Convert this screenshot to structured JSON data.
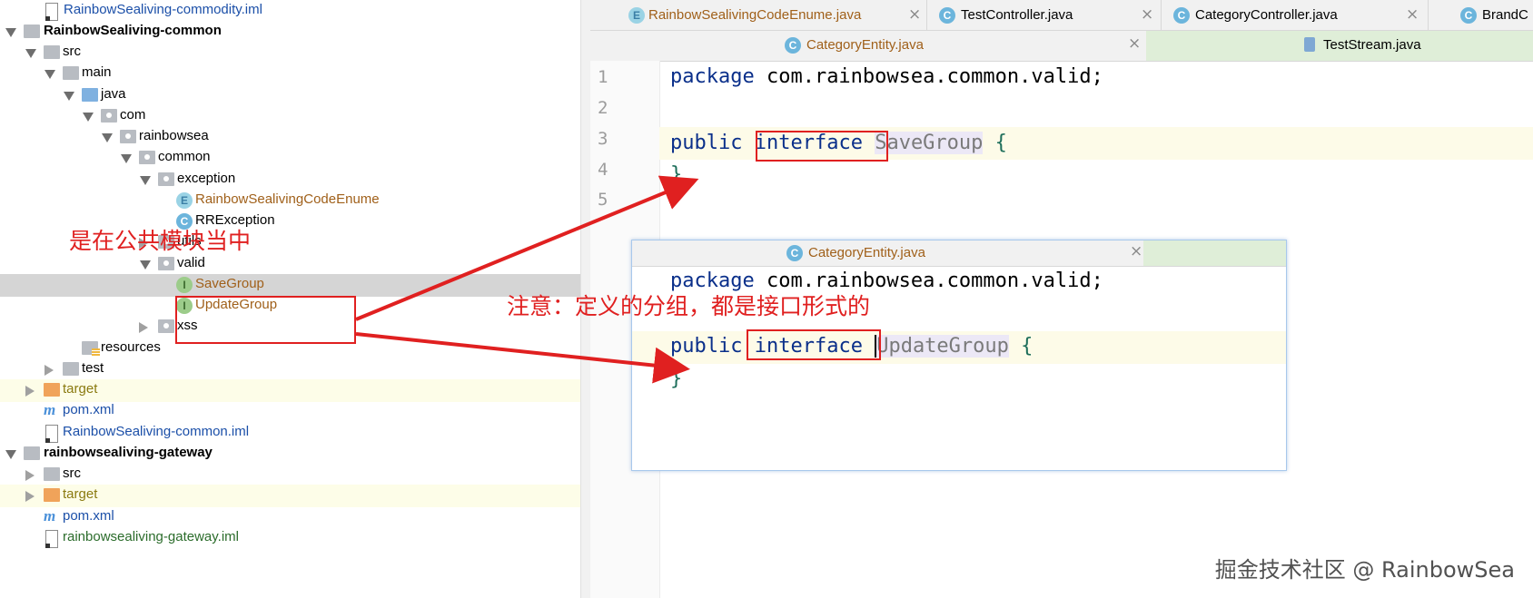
{
  "tree": {
    "rows": [
      {
        "label": "RainbowSealiving-commodity.iml",
        "style": "blue",
        "icon": "iml-file-icon"
      },
      {
        "label": "RainbowSealiving-common",
        "style": "bold",
        "icon": "module-folder-icon"
      },
      {
        "label": "src",
        "icon": "folder-icon"
      },
      {
        "label": "main",
        "icon": "folder-icon"
      },
      {
        "label": "java",
        "icon": "source-folder-icon"
      },
      {
        "label": "com",
        "icon": "package-icon"
      },
      {
        "label": "rainbowsea",
        "icon": "package-icon"
      },
      {
        "label": "common",
        "icon": "package-icon"
      },
      {
        "label": "exception",
        "icon": "package-icon"
      },
      {
        "label": "RainbowSealivingCodeEnume",
        "style": "brown",
        "icon": "enum-icon",
        "badge": "E"
      },
      {
        "label": "RRException",
        "icon": "class-icon",
        "badge": "C"
      },
      {
        "label": "utils",
        "icon": "package-icon"
      },
      {
        "label": "valid",
        "icon": "package-icon"
      },
      {
        "label": "SaveGroup",
        "style": "brown",
        "icon": "interface-icon",
        "badge": "I"
      },
      {
        "label": "UpdateGroup",
        "style": "brown",
        "icon": "interface-icon",
        "badge": "I"
      },
      {
        "label": "xss",
        "icon": "package-icon"
      },
      {
        "label": "resources",
        "icon": "resources-folder-icon"
      },
      {
        "label": "test",
        "icon": "folder-icon"
      },
      {
        "label": "target",
        "style": "olive",
        "icon": "excluded-folder-icon"
      },
      {
        "label": "pom.xml",
        "style": "blue",
        "icon": "maven-icon",
        "badge": "m"
      },
      {
        "label": "RainbowSealiving-common.iml",
        "style": "blue",
        "icon": "iml-file-icon"
      },
      {
        "label": "rainbowsealiving-gateway",
        "style": "bold",
        "icon": "module-folder-icon"
      },
      {
        "label": "src",
        "icon": "folder-icon"
      },
      {
        "label": "target",
        "style": "olive",
        "icon": "excluded-folder-icon"
      },
      {
        "label": "pom.xml",
        "style": "blue",
        "icon": "maven-icon",
        "badge": "m"
      },
      {
        "label": "rainbowsealiving-gateway.iml",
        "style": "green",
        "icon": "iml-file-icon"
      }
    ]
  },
  "tabs_row1": [
    {
      "label": "RainbowSealivingCodeEnume.java",
      "badge": "E",
      "close": "×"
    },
    {
      "label": "TestController.java",
      "badge": "C",
      "close": "×"
    },
    {
      "label": "CategoryController.java",
      "badge": "C",
      "close": "×"
    },
    {
      "label": "BrandC",
      "badge": "C",
      "close": ""
    }
  ],
  "tabs_row2": [
    {
      "label": "CategoryEntity.java",
      "badge": "C",
      "close": "×"
    },
    {
      "label": "TestStream.java",
      "badge": "",
      "close": ""
    }
  ],
  "editor": {
    "line_numbers": [
      "1",
      "2",
      "3",
      "4",
      "5"
    ],
    "line1": {
      "kw": "package",
      "rest": " com.rainbowsea.common.valid;"
    },
    "line3": {
      "kw1": "public",
      "kw2": "interface",
      "name": "SaveGroup",
      "brace": "{"
    },
    "line4": {
      "brace": "}"
    }
  },
  "popup": {
    "tab": {
      "label": "CategoryEntity.java",
      "badge": "C",
      "close": "×"
    },
    "line1": {
      "kw": "package",
      "rest": " com.rainbowsea.common.valid;"
    },
    "line3": {
      "kw1": "public",
      "kw2": "interface",
      "name": "UpdateGroup",
      "brace": "{"
    },
    "line4": {
      "brace": "}"
    }
  },
  "annotations": {
    "common_module": "是在公共模块当中",
    "note": "注意：定义的分组，都是接口形式的"
  },
  "watermark": "掘金技术社区 @ RainbowSea",
  "colors": {
    "annotation": "#e02020",
    "keyword": "#0a2f8a",
    "selection": "#d5d5d5"
  }
}
